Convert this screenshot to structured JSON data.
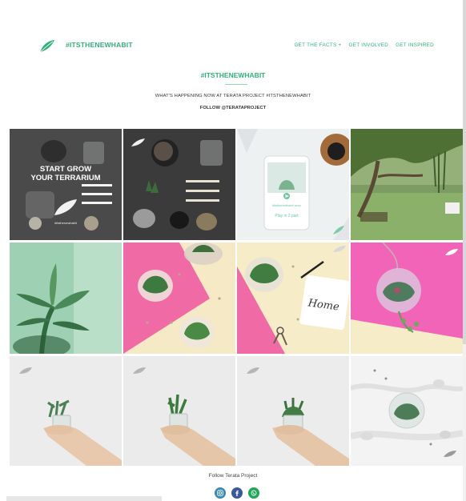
{
  "header": {
    "brand": "#ITSTHENEWHABIT",
    "nav": [
      "GET THE FACTS +",
      "GET INVOLVED",
      "GET INSPIRED"
    ]
  },
  "intro": {
    "title": "#ITSTHENEWHABIT",
    "subtitle": "WHAT'S HAPPENING NOW AT TERATA PROJECT #ITSTHENEWHABIT",
    "follow": "FOLLOW @TERATAPROJECT"
  },
  "grid": {
    "tile1": {
      "line1": "START GROW",
      "line2": "YOUR TERRARIUM",
      "caption": "#itsthenewhabit"
    },
    "tile3": {
      "tablet_caption": "#itsthenewhabit story",
      "tablet_button": "Play in 2 part"
    },
    "tile7": {
      "notebook_text": "Home"
    }
  },
  "footer": {
    "follow_text": "Follow Terata Project",
    "social": [
      "instagram-icon",
      "facebook-icon",
      "whatsapp-icon"
    ]
  },
  "colors": {
    "accent": "#2fb37c",
    "pink": "#ec5c9a",
    "facebook": "#3b5998",
    "whatsapp": "#1aaa56",
    "instagram": "#3a88b8"
  }
}
